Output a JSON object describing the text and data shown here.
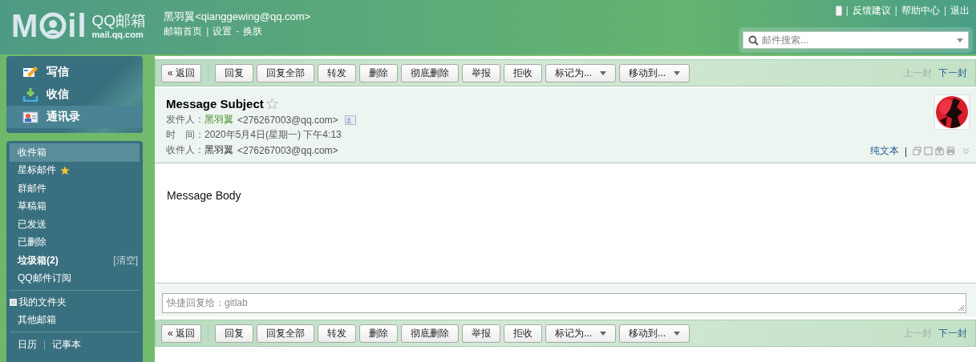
{
  "header": {
    "logo": {
      "before": "M",
      "after": "il"
    },
    "brand": "QQ邮箱",
    "domain": "mail.qq.com",
    "user": "黑羽翼<qianggewing@qq.com>",
    "account_links": [
      {
        "kind": "link",
        "text": "邮箱首页"
      },
      {
        "kind": "sep",
        "text": "|"
      },
      {
        "kind": "link",
        "text": "设置"
      },
      {
        "kind": "sep",
        "text": "-"
      },
      {
        "kind": "link",
        "text": "换肤"
      }
    ],
    "top_links": [
      {
        "kind": "phone"
      },
      {
        "kind": "sep",
        "text": "|"
      },
      {
        "kind": "link",
        "text": "反馈建议"
      },
      {
        "kind": "sep",
        "text": "|"
      },
      {
        "kind": "link",
        "text": "帮助中心"
      },
      {
        "kind": "sep",
        "text": "|"
      },
      {
        "kind": "link",
        "text": "退出"
      }
    ],
    "search": {
      "placeholder": "邮件搜索..."
    }
  },
  "sidebar": {
    "actions": [
      {
        "kind": "compose",
        "label": "写信",
        "selected": false
      },
      {
        "kind": "receive",
        "label": "收信",
        "selected": false
      },
      {
        "kind": "contacts",
        "label": "通讯录",
        "selected": true
      }
    ],
    "folders": [
      {
        "label": "收件箱",
        "selected": true,
        "unread": false
      },
      {
        "label": "星标邮件",
        "selected": false,
        "unread": false,
        "starred": true
      },
      {
        "label": "群邮件",
        "selected": false,
        "unread": false
      },
      {
        "label": "草稿箱",
        "selected": false,
        "unread": false
      },
      {
        "label": "已发送",
        "selected": false,
        "unread": false
      },
      {
        "label": "已删除",
        "selected": false,
        "unread": false
      },
      {
        "label": "垃圾箱(2)",
        "selected": false,
        "unread": true,
        "action": "[清空]"
      },
      {
        "label": "QQ邮件订阅",
        "selected": false,
        "unread": false
      }
    ],
    "my_folders": {
      "label": "我的文件夹",
      "expanded": false
    },
    "other": "其他邮箱",
    "tools": [
      {
        "kind": "link",
        "text": "日历"
      },
      {
        "kind": "sep",
        "text": "|"
      },
      {
        "kind": "link",
        "text": "记事本"
      }
    ]
  },
  "toolbar_top": {
    "buttons": [
      {
        "kind": "back",
        "label": "« 返回"
      },
      {
        "kind": "plain",
        "label": "回复"
      },
      {
        "kind": "plain",
        "label": "回复全部"
      },
      {
        "kind": "plain",
        "label": "转发"
      },
      {
        "kind": "plain",
        "label": "删除"
      },
      {
        "kind": "plain",
        "label": "彻底删除"
      },
      {
        "kind": "plain",
        "label": "举报"
      },
      {
        "kind": "plain",
        "label": "拒收"
      },
      {
        "kind": "dropdown",
        "label": "标记为..."
      },
      {
        "kind": "dropdown",
        "label": "移动到..."
      }
    ],
    "nav": [
      {
        "label": "上一封",
        "disabled": true
      },
      {
        "label": "下一封",
        "disabled": false
      }
    ]
  },
  "message": {
    "subject": "Message Subject",
    "starred": false,
    "fields": [
      {
        "kind": "person",
        "label": "发件人：",
        "name": "黑羽翼",
        "email": "<276267003@qq.com>",
        "highlight": true,
        "card": true
      },
      {
        "kind": "text",
        "label": "时　间：",
        "value": "2020年5月4日(星期一) 下午4:13"
      },
      {
        "kind": "person",
        "label": "收件人：",
        "name": "黑羽翼",
        "email": "<276267003@qq.com>",
        "highlight": false,
        "card": false
      }
    ],
    "view_link": "纯文本",
    "view_sep": "|",
    "body": "Message Body"
  },
  "quick_reply": {
    "placeholder": "快捷回复给：gitlab"
  },
  "toolbar_bottom": {
    "buttons": [
      {
        "kind": "back",
        "label": "« 返回"
      },
      {
        "kind": "plain",
        "label": "回复"
      },
      {
        "kind": "plain",
        "label": "回复全部"
      },
      {
        "kind": "plain",
        "label": "转发"
      },
      {
        "kind": "plain",
        "label": "删除"
      },
      {
        "kind": "plain",
        "label": "彻底删除"
      },
      {
        "kind": "plain",
        "label": "举报"
      },
      {
        "kind": "plain",
        "label": "拒收"
      },
      {
        "kind": "dropdown",
        "label": "标记为..."
      },
      {
        "kind": "dropdown",
        "label": "移动到..."
      }
    ],
    "nav": [
      {
        "label": "上一封",
        "disabled": true
      },
      {
        "label": "下一封",
        "disabled": false
      }
    ]
  }
}
